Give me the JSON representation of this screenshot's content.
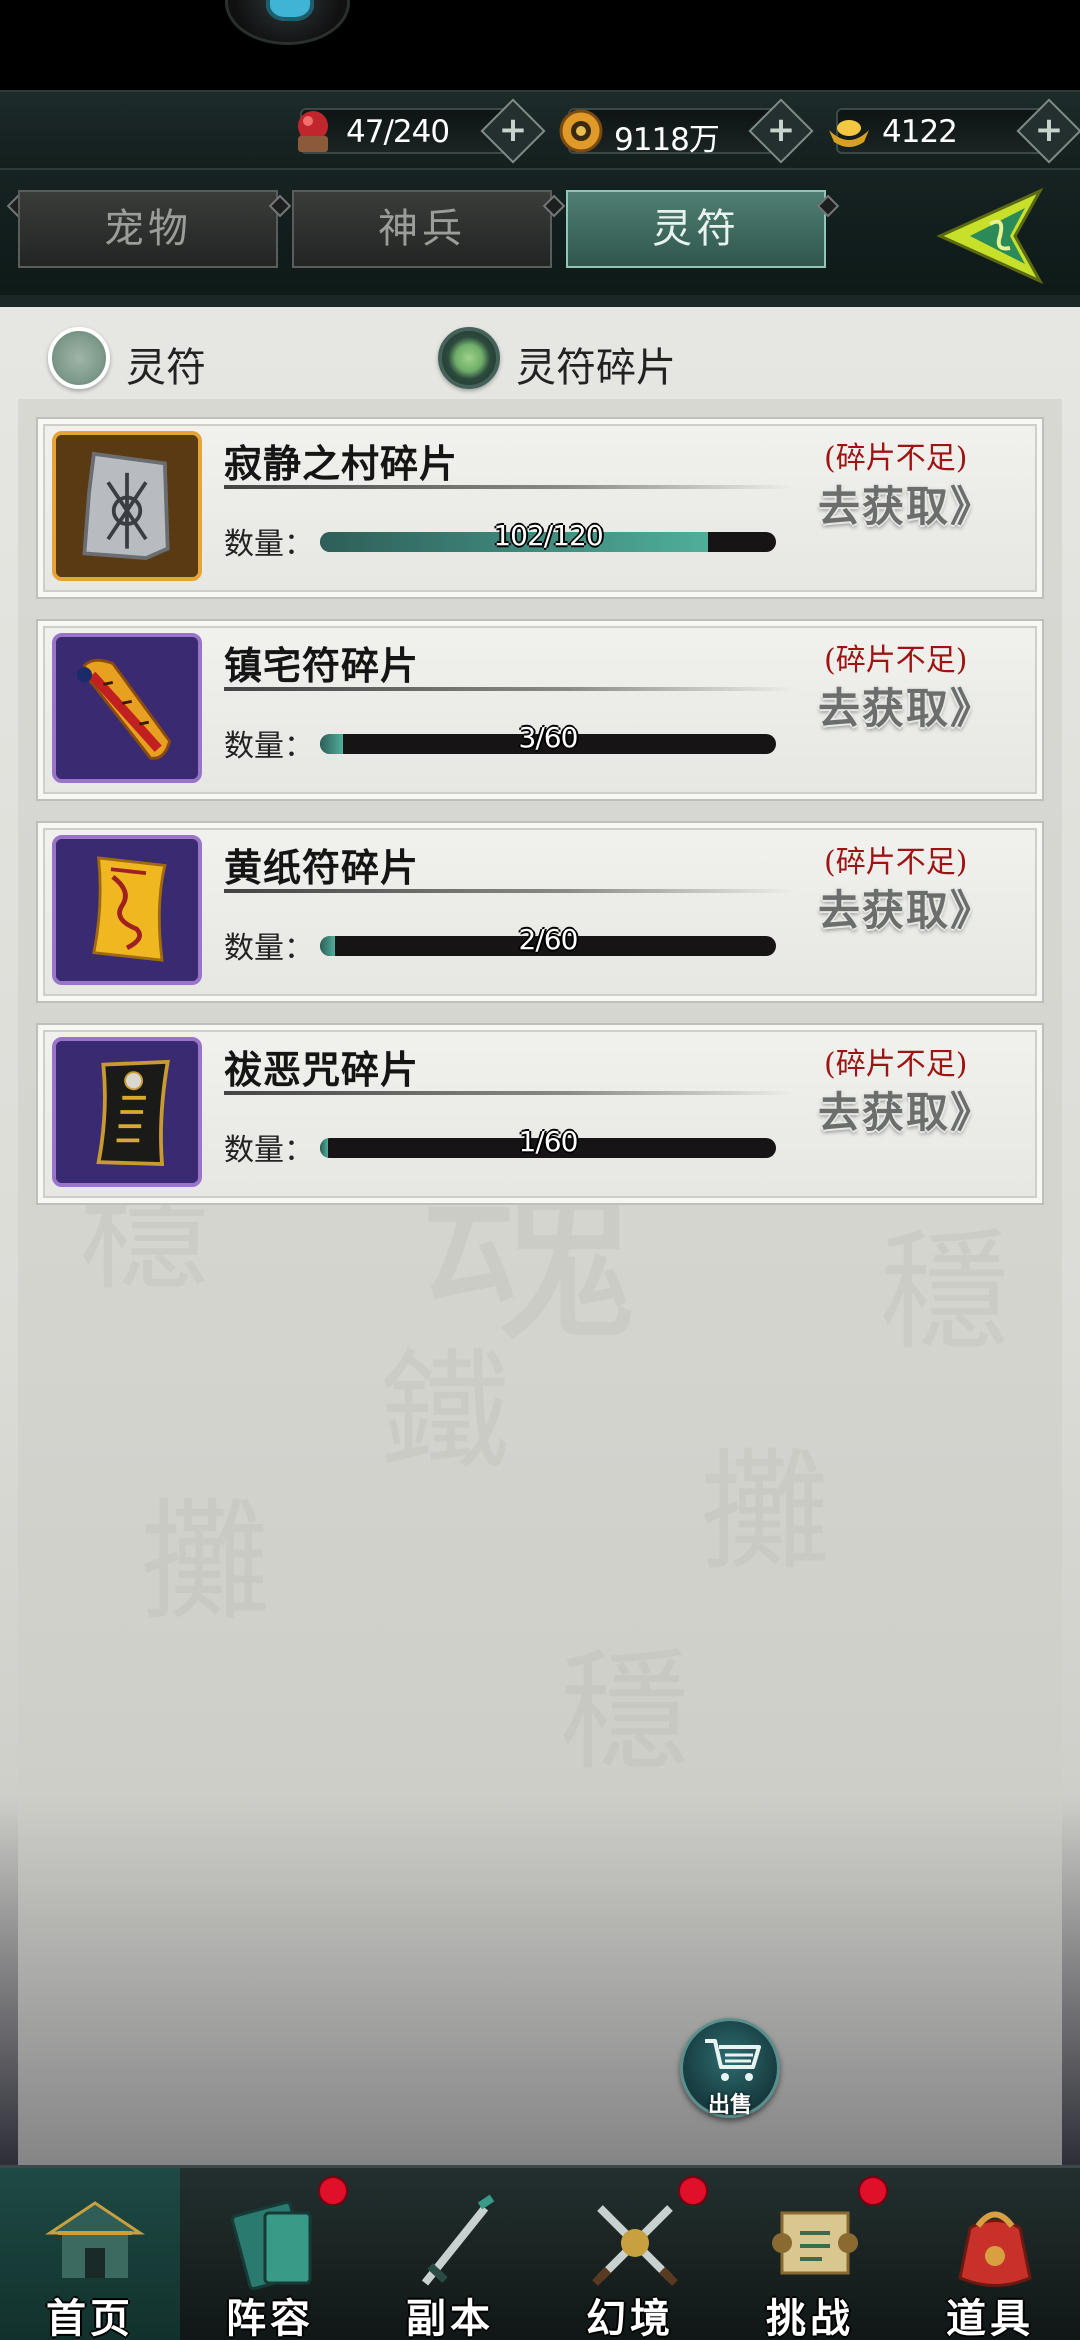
{
  "resources": [
    {
      "icon": "stamina-orb-icon",
      "value": "47/240"
    },
    {
      "icon": "gold-coin-icon",
      "value": "9118万"
    },
    {
      "icon": "ingot-icon",
      "value": "4122"
    }
  ],
  "tabs": [
    {
      "label": "宠物",
      "active": false
    },
    {
      "label": "神兵",
      "active": false
    },
    {
      "label": "灵符",
      "active": true
    }
  ],
  "filters": [
    {
      "label": "灵符",
      "selected": false
    },
    {
      "label": "灵符碎片",
      "selected": true
    }
  ],
  "items": [
    {
      "name": "寂静之村碎片",
      "qty_label": "数量：",
      "owned": 102,
      "required": 120,
      "qty_text": "102/120",
      "status": "(碎片不足)",
      "action": "去获取》",
      "frame": "gold",
      "icon": "silver-talisman-icon"
    },
    {
      "name": "镇宅符碎片",
      "qty_label": "数量：",
      "owned": 3,
      "required": 60,
      "qty_text": "3/60",
      "status": "(碎片不足)",
      "action": "去获取》",
      "frame": "purple",
      "icon": "red-talisman-icon"
    },
    {
      "name": "黄纸符碎片",
      "qty_label": "数量：",
      "owned": 2,
      "required": 60,
      "qty_text": "2/60",
      "status": "(碎片不足)",
      "action": "去获取》",
      "frame": "purple",
      "icon": "yellow-talisman-icon"
    },
    {
      "name": "祓恶咒碎片",
      "qty_label": "数量：",
      "owned": 1,
      "required": 60,
      "qty_text": "1/60",
      "status": "(碎片不足)",
      "action": "去获取》",
      "frame": "purple",
      "icon": "black-talisman-icon"
    }
  ],
  "sell_button": {
    "label": "出售"
  },
  "bottom_nav": [
    {
      "label": "首页",
      "icon": "palace-icon",
      "badge": false
    },
    {
      "label": "阵容",
      "icon": "book-icon",
      "badge": true
    },
    {
      "label": "副本",
      "icon": "sword-icon",
      "badge": false
    },
    {
      "label": "幻境",
      "icon": "crossed-swords-icon",
      "badge": true
    },
    {
      "label": "挑战",
      "icon": "scroll-icon",
      "badge": true
    },
    {
      "label": "道具",
      "icon": "bag-icon",
      "badge": false
    }
  ],
  "colors": {
    "accent": "#4fae9a",
    "status_red": "#9e1414",
    "badge_red": "#e0102a",
    "gold_frame": "#e6a437",
    "purple_frame": "#9a74c8"
  }
}
